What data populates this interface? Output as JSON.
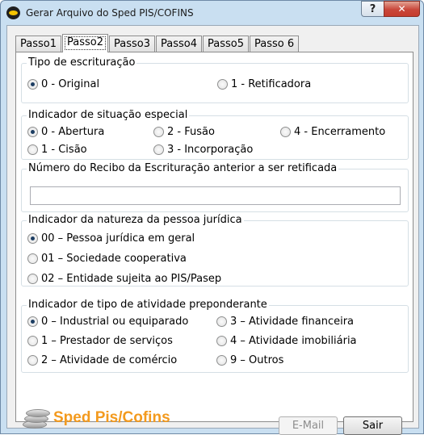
{
  "window": {
    "title": "Gerar Arquivo do Sped PIS/COFINS",
    "help_label": "?",
    "close_label": "✕",
    "app_icon": "sped-icon"
  },
  "tabs": [
    {
      "label": "Passo1",
      "active": false
    },
    {
      "label": "Passo2",
      "active": true
    },
    {
      "label": "Passo3",
      "active": false
    },
    {
      "label": "Passo4",
      "active": false
    },
    {
      "label": "Passo5",
      "active": false
    },
    {
      "label": "Passo 6",
      "active": false
    }
  ],
  "tipo_escrituracao": {
    "legend": "Tipo de escrituração",
    "options": [
      {
        "label": "0 - Original",
        "selected": true
      },
      {
        "label": "1 - Retificadora",
        "selected": false
      }
    ]
  },
  "situacao_especial": {
    "legend": "Indicador de situação especial",
    "options": [
      {
        "label": "0 - Abertura",
        "selected": true
      },
      {
        "label": "2 - Fusão",
        "selected": false
      },
      {
        "label": "4 - Encerramento",
        "selected": false
      },
      {
        "label": "1 - Cisão",
        "selected": false
      },
      {
        "label": "3 - Incorporação",
        "selected": false
      }
    ]
  },
  "recibo": {
    "legend": "Número do Recibo da Escrituração anterior a ser retificada",
    "value": ""
  },
  "natureza_pj": {
    "legend": "Indicador da natureza da pessoa jurídica",
    "options": [
      {
        "label": "00 – Pessoa jurídica em geral",
        "selected": true
      },
      {
        "label": "01 – Sociedade cooperativa",
        "selected": false
      },
      {
        "label": "02 – Entidade sujeita ao PIS/Pasep",
        "selected": false
      }
    ]
  },
  "atividade": {
    "legend": "Indicador de tipo de atividade preponderante",
    "options": [
      {
        "label": "0 – Industrial ou equiparado",
        "selected": true
      },
      {
        "label": "3 – Atividade financeira",
        "selected": false
      },
      {
        "label": "1 – Prestador de serviços",
        "selected": false
      },
      {
        "label": "4 – Atividade imobiliária",
        "selected": false
      },
      {
        "label": "2 – Atividade de comércio",
        "selected": false
      },
      {
        "label": "9 – Outros",
        "selected": false
      }
    ]
  },
  "footer": {
    "logo_text": "Sped Pis/Cofins",
    "email_label": "E-Mail",
    "email_enabled": false,
    "exit_label": "Sair"
  }
}
